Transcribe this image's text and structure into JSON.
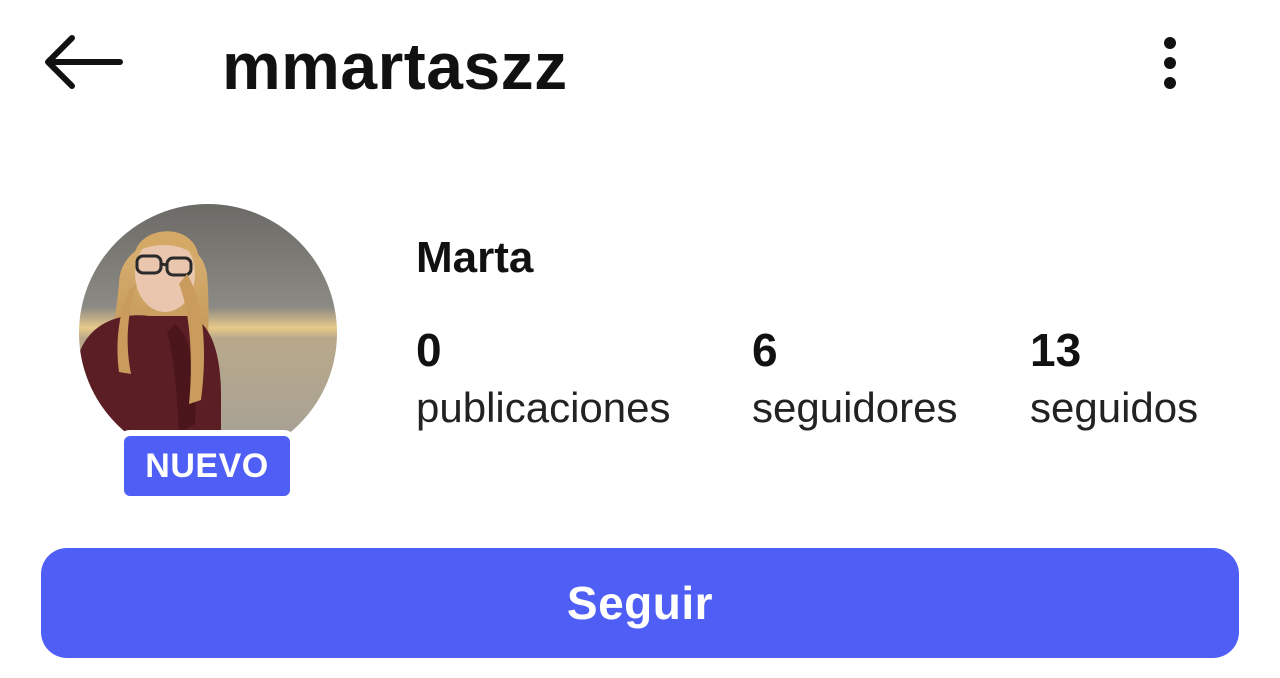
{
  "header": {
    "back_icon": "arrow-left-icon",
    "username": "mmartaszz",
    "more_icon": "more-vertical-icon"
  },
  "profile": {
    "display_name": "Marta",
    "avatar": "profile-photo",
    "badge_label": "NUEVO",
    "stats": [
      {
        "value": "0",
        "label": "publicaciones"
      },
      {
        "value": "6",
        "label": "seguidores"
      },
      {
        "value": "13",
        "label": "seguidos"
      }
    ]
  },
  "actions": {
    "follow_label": "Seguir"
  },
  "colors": {
    "accent": "#4f5ff5",
    "text": "#111111",
    "background": "#ffffff"
  }
}
